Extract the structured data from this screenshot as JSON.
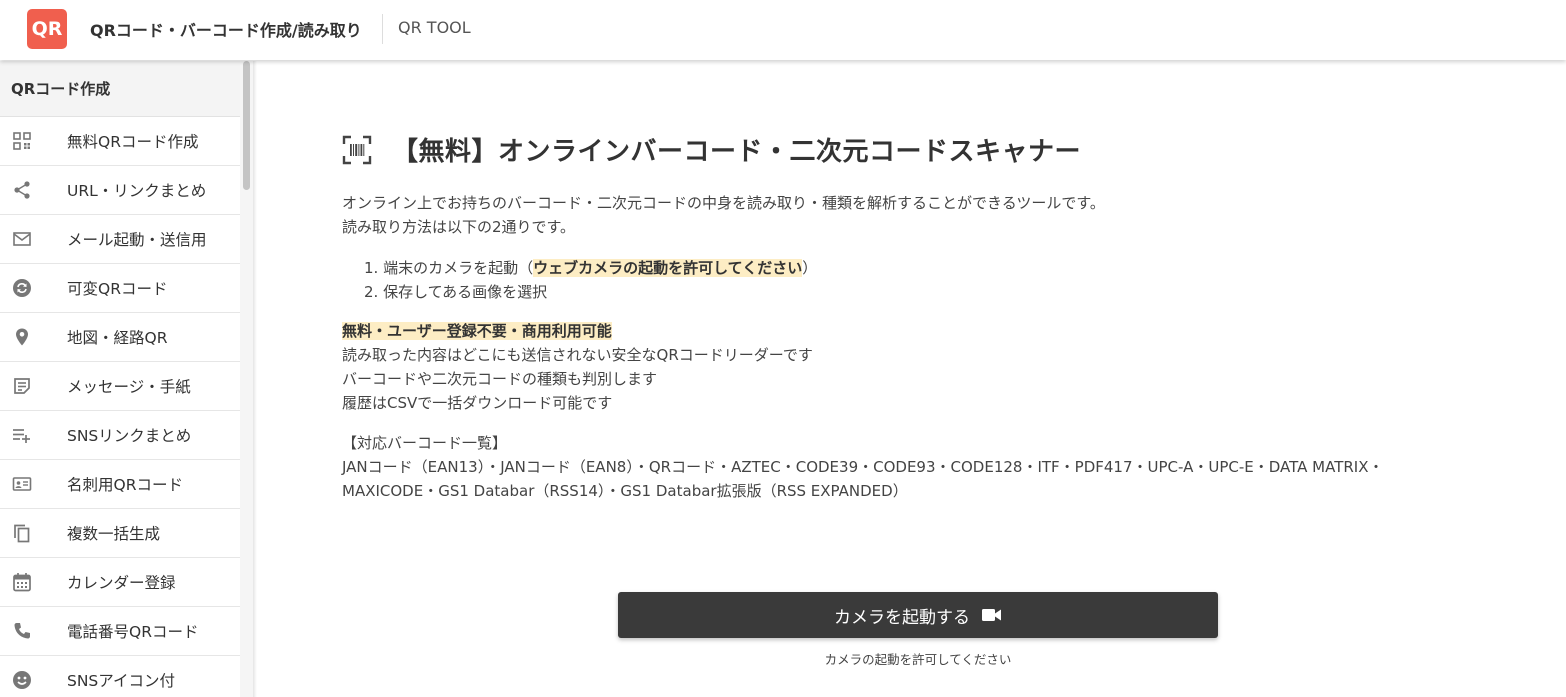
{
  "header": {
    "logo_text": "QR",
    "app_title": "QRコード・バーコード作成/読み取り",
    "sub_title": "QR TOOL",
    "brand_color": "#f05f4e"
  },
  "sidebar": {
    "heading": "QRコード作成",
    "items": [
      {
        "label": "無料QRコード作成",
        "icon": "qr-icon"
      },
      {
        "label": "URL・リンクまとめ",
        "icon": "share-icon"
      },
      {
        "label": "メール起動・送信用",
        "icon": "mail-icon"
      },
      {
        "label": "可変QRコード",
        "icon": "sync-icon"
      },
      {
        "label": "地図・経路QR",
        "icon": "map-pin-icon"
      },
      {
        "label": "メッセージ・手紙",
        "icon": "note-icon"
      },
      {
        "label": "SNSリンクまとめ",
        "icon": "playlist-add-icon"
      },
      {
        "label": "名刺用QRコード",
        "icon": "id-card-icon"
      },
      {
        "label": "複数一括生成",
        "icon": "copy-icon"
      },
      {
        "label": "カレンダー登録",
        "icon": "calendar-icon"
      },
      {
        "label": "電話番号QRコード",
        "icon": "phone-icon"
      },
      {
        "label": "SNSアイコン付",
        "icon": "smiley-icon"
      }
    ]
  },
  "main": {
    "title": "【無料】オンラインバーコード・二次元コードスキャナー",
    "title_icon": "barcode-scan-icon",
    "intro": [
      "オンライン上でお持ちのバーコード・二次元コードの中身を読み取り・種類を解析することができるツールです。",
      "読み取り方法は以下の2通りです。"
    ],
    "steps": [
      {
        "prefix": "1. 端末のカメラを起動（",
        "highlight": "ウェブカメラの起動を許可してください",
        "suffix": "）"
      },
      {
        "prefix": "2. 保存してある画像を選択",
        "highlight": "",
        "suffix": ""
      }
    ],
    "feature_highlight": "無料・ユーザー登録不要・商用利用可能",
    "features": [
      "読み取った内容はどこにも送信されない安全なQRコードリーダーです",
      "バーコードや二次元コードの種類も判別します",
      "履歴はCSVで一括ダウンロード可能です"
    ],
    "supported_heading": "【対応バーコード一覧】",
    "supported_lines": [
      "JANコード（EAN13）・JANコード（EAN8）・QRコード・AZTEC・CODE39・CODE93・CODE128・ITF・PDF417・UPC-A・UPC-E・DATA MATRIX・",
      "MAXICODE・GS1 Databar（RSS14）・GS1 Databar拡張版（RSS EXPANDED）"
    ],
    "camera_button_label": "カメラを起動する",
    "camera_note": "カメラの起動を許可してください"
  }
}
